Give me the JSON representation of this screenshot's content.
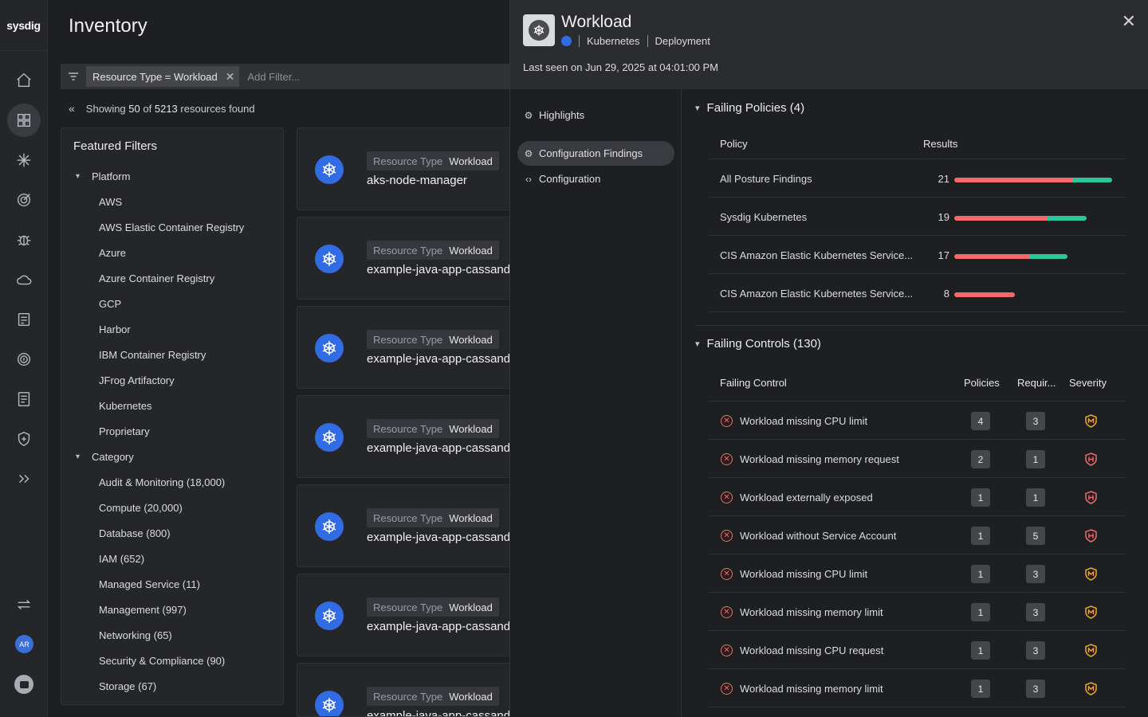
{
  "nav": {
    "logo": "sysdig",
    "avatar": "AR"
  },
  "main": {
    "title": "Inventory",
    "filter_chip": "Resource Type = Workload",
    "add_filter": "Add Filter...",
    "showing_prefix": "Showing",
    "showing_count": "50",
    "showing_of": "of",
    "showing_total": "5213",
    "showing_suffix": "resources found"
  },
  "featured_filters": {
    "title": "Featured Filters",
    "groups": [
      {
        "label": "Platform",
        "items": [
          "AWS",
          "AWS Elastic Container Registry",
          "Azure",
          "Azure Container Registry",
          "GCP",
          "Harbor",
          "IBM Container Registry",
          "JFrog Artifactory",
          "Kubernetes",
          "Proprietary"
        ]
      },
      {
        "label": "Category",
        "items": [
          "Audit & Monitoring (18,000)",
          "Compute (20,000)",
          "Database (800)",
          "IAM (652)",
          "Managed Service (11)",
          "Management (997)",
          "Networking (65)",
          "Security & Compliance (90)",
          "Storage (67)"
        ]
      }
    ]
  },
  "cards": [
    {
      "tag_key": "Resource Type",
      "tag_value": "Workload",
      "name": "aks-node-manager"
    },
    {
      "tag_key": "Resource Type",
      "tag_value": "Workload",
      "name": "example-java-app-cassandra"
    },
    {
      "tag_key": "Resource Type",
      "tag_value": "Workload",
      "name": "example-java-app-cassandra"
    },
    {
      "tag_key": "Resource Type",
      "tag_value": "Workload",
      "name": "example-java-app-cassandra"
    },
    {
      "tag_key": "Resource Type",
      "tag_value": "Workload",
      "name": "example-java-app-cassandra"
    },
    {
      "tag_key": "Resource Type",
      "tag_value": "Workload",
      "name": "example-java-app-cassandra"
    },
    {
      "tag_key": "Resource Type",
      "tag_value": "Workload",
      "name": "example-java-app-cassandra"
    }
  ],
  "drawer": {
    "title": "Workload",
    "platform": "Kubernetes",
    "kind": "Deployment",
    "last_seen": "Last seen on Jun 29, 2025 at 04:01:00 PM",
    "close_icon": "close-icon",
    "nav": [
      "Highlights",
      "Configuration Findings",
      "Configuration"
    ],
    "failing_policies": {
      "title": "Failing Policies (4)",
      "col_policy": "Policy",
      "col_results": "Results",
      "rows": [
        {
          "name": "All Posture Findings",
          "count": "21",
          "failed": 0.75,
          "passed": 0.25
        },
        {
          "name": "Sysdig Kubernetes",
          "count": "19",
          "failed": 0.7,
          "passed": 0.3
        },
        {
          "name": "CIS Amazon Elastic Kubernetes Service...",
          "count": "17",
          "failed": 0.66,
          "passed": 0.34
        },
        {
          "name": "CIS Amazon Elastic Kubernetes Service...",
          "count": "8",
          "failed": 1.0,
          "passed": 0.0
        }
      ]
    },
    "failing_controls": {
      "title": "Failing Controls (130)",
      "col_control": "Failing Control",
      "col_policies": "Policies",
      "col_requirements": "Requir...",
      "col_severity": "Severity",
      "rows": [
        {
          "name": "Workload missing CPU limit",
          "policies": "4",
          "requirements": "3",
          "severity": "medium",
          "color": "#f5a623"
        },
        {
          "name": "Workload missing memory request",
          "policies": "2",
          "requirements": "1",
          "severity": "high",
          "color": "#f26b6b"
        },
        {
          "name": "Workload externally exposed",
          "policies": "1",
          "requirements": "1",
          "severity": "high",
          "color": "#f26b6b"
        },
        {
          "name": "Workload without Service Account",
          "policies": "1",
          "requirements": "5",
          "severity": "high",
          "color": "#f26b6b"
        },
        {
          "name": "Workload missing CPU limit",
          "policies": "1",
          "requirements": "3",
          "severity": "medium",
          "color": "#f5a623"
        },
        {
          "name": "Workload missing memory limit",
          "policies": "1",
          "requirements": "3",
          "severity": "medium",
          "color": "#f5a623"
        },
        {
          "name": "Workload missing CPU request",
          "policies": "1",
          "requirements": "3",
          "severity": "medium",
          "color": "#f5a623"
        },
        {
          "name": "Workload missing memory limit",
          "policies": "1",
          "requirements": "3",
          "severity": "medium",
          "color": "#f5a623"
        }
      ]
    }
  }
}
